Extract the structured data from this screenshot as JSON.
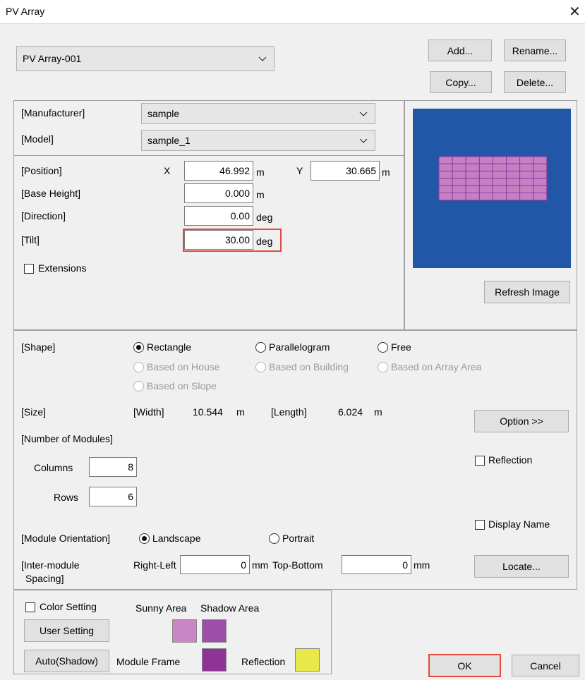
{
  "window": {
    "title": "PV Array",
    "close": "✕"
  },
  "array_select": {
    "value": "PV Array-001"
  },
  "top_buttons": {
    "add": "Add...",
    "rename": "Rename...",
    "copy": "Copy...",
    "delete": "Delete..."
  },
  "module": {
    "manufacturer_label": "[Manufacturer]",
    "manufacturer_value": "sample",
    "model_label": "[Model]",
    "model_value": "sample_1"
  },
  "position": {
    "label": "[Position]",
    "x_label": "X",
    "x_value": "46.992",
    "x_unit": "m",
    "y_label": "Y",
    "y_value": "30.665",
    "y_unit": "m"
  },
  "base_height": {
    "label": "[Base Height]",
    "value": "0.000",
    "unit": "m"
  },
  "direction": {
    "label": "[Direction]",
    "value": "0.00",
    "unit": "deg"
  },
  "tilt": {
    "label": "[Tilt]",
    "value": "30.00",
    "unit": "deg"
  },
  "extensions": {
    "label": "Extensions",
    "checked": false
  },
  "preview": {
    "refresh_label": "Refresh Image",
    "bg_color": "#2257a8",
    "module_color": "#c77fc4",
    "grid_color": "#8a3a9e",
    "columns": 8,
    "rows": 6
  },
  "shape": {
    "label": "[Shape]",
    "options": {
      "rectangle": "Rectangle",
      "parallelogram": "Parallelogram",
      "free": "Free",
      "based_on_house": "Based on House",
      "based_on_building": "Based on Building",
      "based_on_array_area": "Based on Array Area",
      "based_on_slope": "Based on Slope"
    },
    "selected": "Rectangle"
  },
  "size": {
    "label": "[Size]",
    "width_label": "[Width]",
    "width_value": "10.544",
    "width_unit": "m",
    "length_label": "[Length]",
    "length_value": "6.024",
    "length_unit": "m"
  },
  "option_button": "Option >>",
  "modules_count": {
    "label": "[Number of Modules]",
    "columns_label": "Columns",
    "columns_value": "8",
    "rows_label": "Rows",
    "rows_value": "6"
  },
  "reflection_checkbox": {
    "label": "Reflection",
    "checked": false
  },
  "display_name_checkbox": {
    "label": "Display Name",
    "checked": false
  },
  "orientation": {
    "label": "[Module Orientation]",
    "landscape": "Landscape",
    "portrait": "Portrait",
    "selected": "Landscape"
  },
  "spacing": {
    "label_line1": "[Inter-module",
    "label_line2": "Spacing]",
    "right_left_label": "Right-Left",
    "right_left_value": "0",
    "right_left_unit": "mm",
    "top_bottom_label": "Top-Bottom",
    "top_bottom_value": "0",
    "top_bottom_unit": "mm"
  },
  "locate_button": "Locate...",
  "color": {
    "setting_label": "Color Setting",
    "sunny_area_label": "Sunny Area",
    "shadow_area_label": "Shadow Area",
    "user_setting_button": "User Setting",
    "auto_shadow_button": "Auto(Shadow)",
    "module_frame_label": "Module Frame",
    "reflection_label": "Reflection",
    "sunny_color": "#c985c4",
    "shadow_color": "#9b4fa6",
    "frame_color": "#8e3496",
    "reflection_color": "#e8e84a"
  },
  "dialog_buttons": {
    "ok": "OK",
    "cancel": "Cancel"
  }
}
